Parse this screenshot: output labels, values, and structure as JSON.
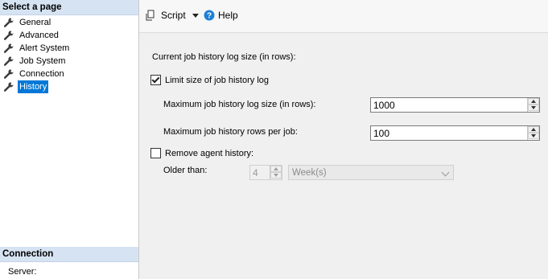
{
  "left_pane": {
    "header": "Select a page",
    "items": [
      {
        "label": "General",
        "icon": "wrench-icon"
      },
      {
        "label": "Advanced",
        "icon": "wrench-icon"
      },
      {
        "label": "Alert System",
        "icon": "wrench-icon"
      },
      {
        "label": "Job System",
        "icon": "wrench-icon"
      },
      {
        "label": "Connection",
        "icon": "wrench-icon"
      },
      {
        "label": "History",
        "icon": "wrench-icon",
        "selected": true
      }
    ],
    "connection_header": "Connection",
    "server_label": "Server:"
  },
  "toolbar": {
    "script_label": "Script",
    "help_label": "Help"
  },
  "history": {
    "section_label": "Current job history log size (in rows):",
    "limit_checkbox_label": "Limit size of job history log",
    "limit_checked": true,
    "max_log_label": "Maximum job history log size (in rows):",
    "max_log_value": "1000",
    "max_rows_label": "Maximum job history rows per job:",
    "max_rows_value": "100",
    "remove_checkbox_label": "Remove agent history:",
    "remove_checked": false,
    "older_than_label": "Older than:",
    "older_than_value": "4",
    "older_than_unit": "Week(s)"
  },
  "colors": {
    "selection": "#0078d7",
    "pane_header": "#d6e3f2",
    "help_icon": "#1e7fd6"
  }
}
